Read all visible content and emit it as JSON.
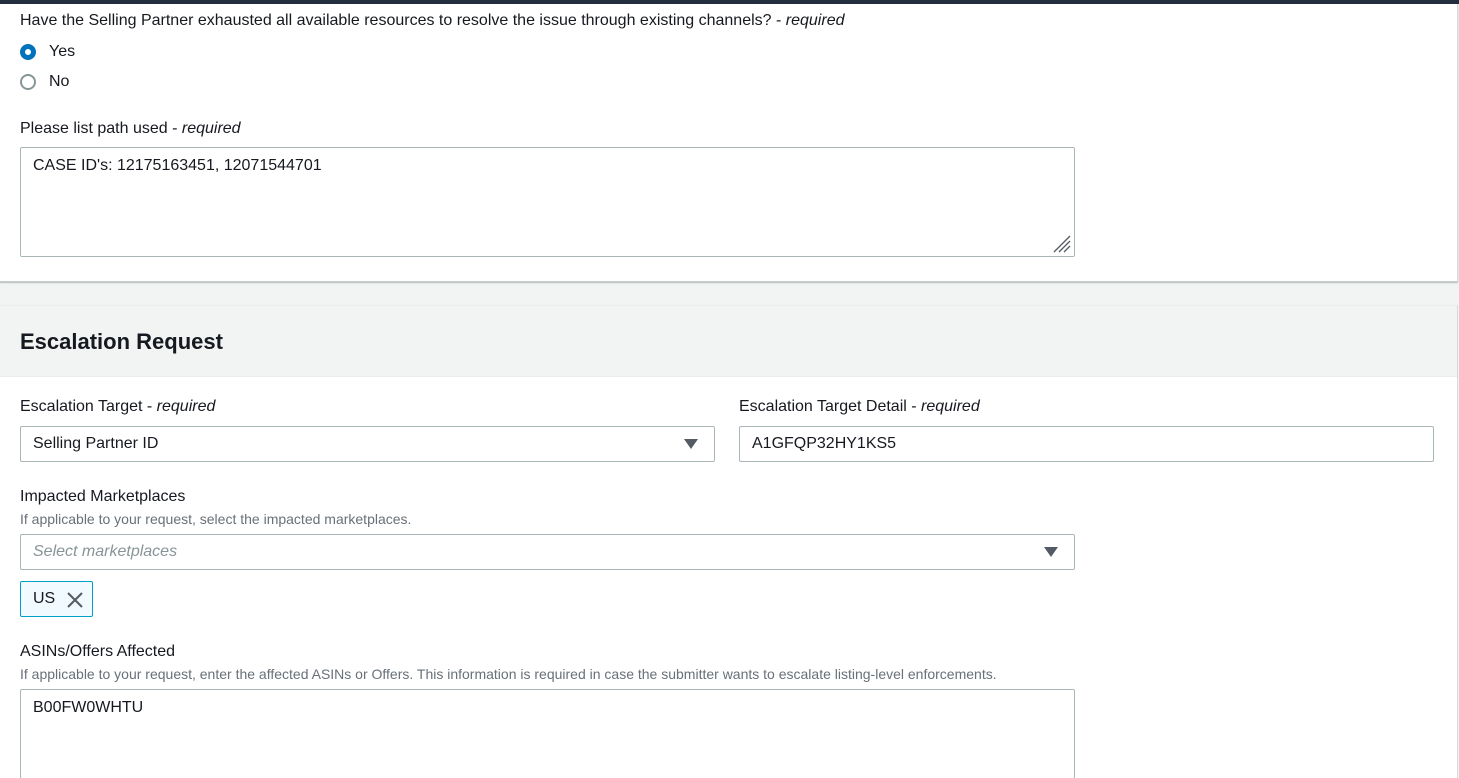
{
  "exhausted_question": {
    "label": "Have the Selling Partner exhausted all available resources to resolve the issue through existing channels?",
    "required_text": "required",
    "options": [
      {
        "label": "Yes",
        "checked": true
      },
      {
        "label": "No",
        "checked": false
      }
    ]
  },
  "path_used": {
    "label": "Please list path used",
    "required_text": "required",
    "value": "CASE ID's: 12175163451, 12071544701"
  },
  "escalation_request": {
    "title": "Escalation Request",
    "target": {
      "label": "Escalation Target",
      "required_text": "required",
      "selected": "Selling Partner ID"
    },
    "target_detail": {
      "label": "Escalation Target Detail",
      "required_text": "required",
      "value": "A1GFQP32HY1KS5"
    },
    "marketplaces": {
      "label": "Impacted Marketplaces",
      "description": "If applicable to your request, select the impacted marketplaces.",
      "placeholder": "Select marketplaces",
      "tokens": [
        "US"
      ]
    },
    "asins": {
      "label": "ASINs/Offers Affected",
      "description": "If applicable to your request, enter the affected ASINs or Offers. This information is required in case the submitter wants to escalate listing-level enforcements.",
      "value": "B00FW0WHTU"
    }
  },
  "colors": {
    "accent": "#0073bb",
    "token_border": "#00a1c9",
    "token_bg": "#f1faff",
    "header_bar": "#232f3e"
  },
  "icons": [
    "radio-selected",
    "radio-unselected",
    "resize-handle-icon",
    "caret-down-icon",
    "close-icon"
  ]
}
